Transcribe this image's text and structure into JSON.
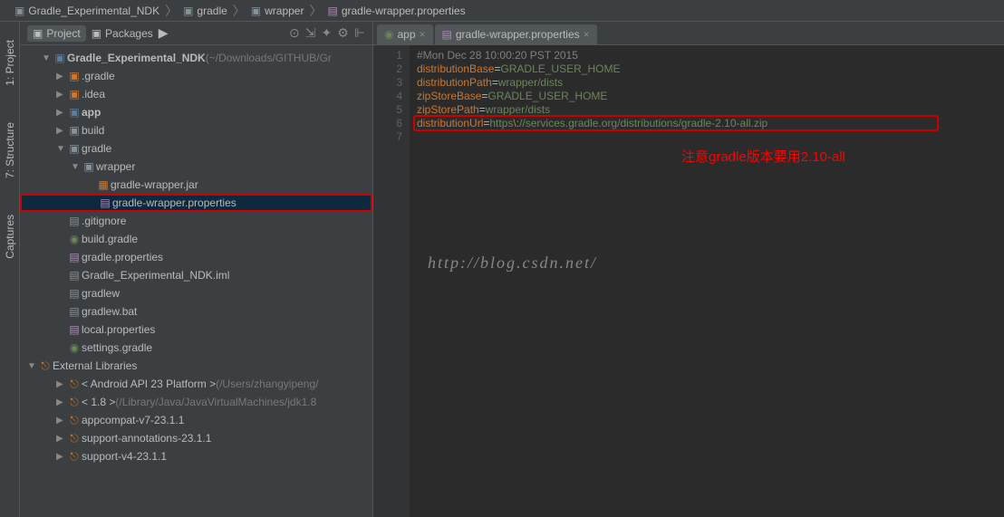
{
  "breadcrumbs": [
    "Gradle_Experimental_NDK",
    "gradle",
    "wrapper",
    "gradle-wrapper.properties"
  ],
  "panel": {
    "projectTab": "Project",
    "packagesTab": "Packages"
  },
  "sidebarTabs": [
    "1: Project",
    "7: Structure",
    "Captures"
  ],
  "tree": {
    "root": "Gradle_Experimental_NDK",
    "rootHint": "(~/Downloads/GITHUB/Gr",
    "items": [
      {
        "l": ".gradle",
        "t": "folder-red",
        "arrow": "▶",
        "indent": 2
      },
      {
        "l": ".idea",
        "t": "folder-red",
        "arrow": "▶",
        "indent": 2
      },
      {
        "l": "app",
        "t": "folder-src",
        "arrow": "▶",
        "indent": 2,
        "bold": true
      },
      {
        "l": "build",
        "t": "folder",
        "arrow": "▶",
        "indent": 2
      },
      {
        "l": "gradle",
        "t": "folder",
        "arrow": "▼",
        "indent": 2
      },
      {
        "l": "wrapper",
        "t": "folder",
        "arrow": "▼",
        "indent": 3
      },
      {
        "l": "gradle-wrapper.jar",
        "t": "jar",
        "arrow": "",
        "indent": 4
      },
      {
        "l": "gradle-wrapper.properties",
        "t": "props",
        "arrow": "",
        "indent": 4,
        "selected": true,
        "highlighted": true
      },
      {
        "l": ".gitignore",
        "t": "file",
        "arrow": "",
        "indent": 2
      },
      {
        "l": "build.gradle",
        "t": "gradle",
        "arrow": "",
        "indent": 2
      },
      {
        "l": "gradle.properties",
        "t": "props",
        "arrow": "",
        "indent": 2
      },
      {
        "l": "Gradle_Experimental_NDK.iml",
        "t": "file",
        "arrow": "",
        "indent": 2
      },
      {
        "l": "gradlew",
        "t": "file",
        "arrow": "",
        "indent": 2
      },
      {
        "l": "gradlew.bat",
        "t": "file",
        "arrow": "",
        "indent": 2
      },
      {
        "l": "local.properties",
        "t": "props",
        "arrow": "",
        "indent": 2
      },
      {
        "l": "settings.gradle",
        "t": "gradle",
        "arrow": "",
        "indent": 2
      }
    ],
    "extLib": "External Libraries",
    "libs": [
      {
        "l": "< Android API 23 Platform >",
        "h": "(/Users/zhangyipeng/"
      },
      {
        "l": "< 1.8 >",
        "h": "(/Library/Java/JavaVirtualMachines/jdk1.8"
      },
      {
        "l": "appcompat-v7-23.1.1",
        "h": ""
      },
      {
        "l": "support-annotations-23.1.1",
        "h": ""
      },
      {
        "l": "support-v4-23.1.1",
        "h": ""
      }
    ]
  },
  "editorTabs": [
    {
      "label": "app",
      "icon": "gradle"
    },
    {
      "label": "gradle-wrapper.properties",
      "icon": "props"
    }
  ],
  "code": {
    "lines": [
      {
        "n": 1,
        "comment": "#Mon Dec 28 10:00:20 PST 2015"
      },
      {
        "n": 2,
        "k": "distributionBase",
        "v": "GRADLE_USER_HOME"
      },
      {
        "n": 3,
        "k": "distributionPath",
        "v": "wrapper/dists"
      },
      {
        "n": 4,
        "k": "zipStoreBase",
        "v": "GRADLE_USER_HOME"
      },
      {
        "n": 5,
        "k": "zipStorePath",
        "v": "wrapper/dists"
      },
      {
        "n": 6,
        "k": "distributionUrl",
        "v1": "https",
        "esc": "\\:",
        "v2": "//services.gradle.org/distributions/gradle-2.10-all.zip"
      },
      {
        "n": 7
      }
    ]
  },
  "annotation": "注意gradle版本要用2.10-all",
  "watermark": "http://blog.csdn.net/"
}
